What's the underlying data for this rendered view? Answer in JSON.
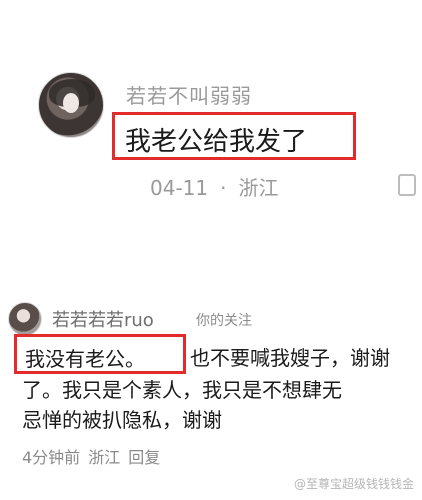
{
  "top_comment": {
    "username": "若若不叫弱弱",
    "message": "我老公给我发了",
    "date": "04-11",
    "separator": "·",
    "location": "浙江",
    "reply_glyph": "回"
  },
  "bottom_comment": {
    "username": "若若若若ruo",
    "follow_tag": "你的关注",
    "highlighted_text": "我没有老公。",
    "line1_rest": "也不要喊我嫂子，谢谢",
    "line2": "了。我只是个素人，我只是不想肆无",
    "line3": "忌惮的被扒隐私，谢谢",
    "time": "4分钟前",
    "location": "浙江",
    "reply": "回复"
  },
  "watermark": "@至尊宝超级钱钱钱金",
  "colors": {
    "highlight_border": "#e32b2b",
    "muted_text": "#9a9a9a"
  }
}
